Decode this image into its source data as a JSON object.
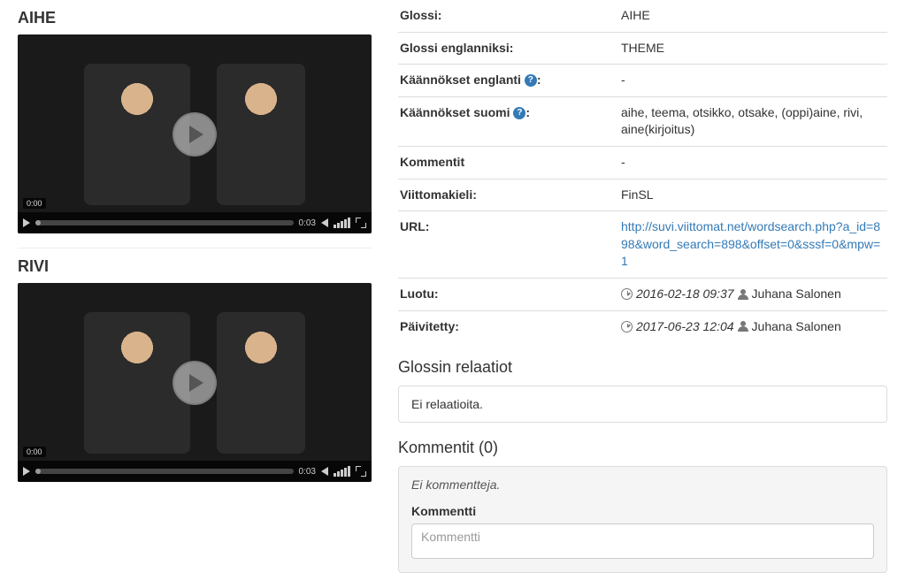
{
  "videos": [
    {
      "title": "AIHE",
      "current_time": "0:00",
      "duration": "0:03"
    },
    {
      "title": "RIVI",
      "current_time": "0:00",
      "duration": "0:03"
    }
  ],
  "info": {
    "glossi_label": "Glossi:",
    "glossi_value": "AIHE",
    "glossi_en_label": "Glossi englanniksi:",
    "glossi_en_value": "THEME",
    "trans_en_label": "Käännökset englanti",
    "trans_en_suffix": ":",
    "trans_en_value": "-",
    "trans_fi_label": "Käännökset suomi",
    "trans_fi_suffix": ":",
    "trans_fi_value": "aihe, teema, otsikko, otsake, (oppi)aine, rivi, aine(kirjoitus)",
    "comments_label": "Kommentit",
    "comments_value": "-",
    "signlang_label": "Viittomakieli:",
    "signlang_value": "FinSL",
    "url_label": "URL:",
    "url_value": "http://suvi.viittomat.net/wordsearch.php?a_id=898&word_search=898&offset=0&sssf=0&mpw=1",
    "created_label": "Luotu:",
    "created_time": "2016-02-18 09:37",
    "created_by": "Juhana Salonen",
    "updated_label": "Päivitetty:",
    "updated_time": "2017-06-23 12:04",
    "updated_by": "Juhana Salonen"
  },
  "relations": {
    "title": "Glossin relaatiot",
    "empty_text": "Ei relaatioita."
  },
  "comments": {
    "title": "Kommentit (0)",
    "empty_text": "Ei kommentteja.",
    "form_label": "Kommentti",
    "placeholder": "Kommentti"
  },
  "help_symbol": "?"
}
